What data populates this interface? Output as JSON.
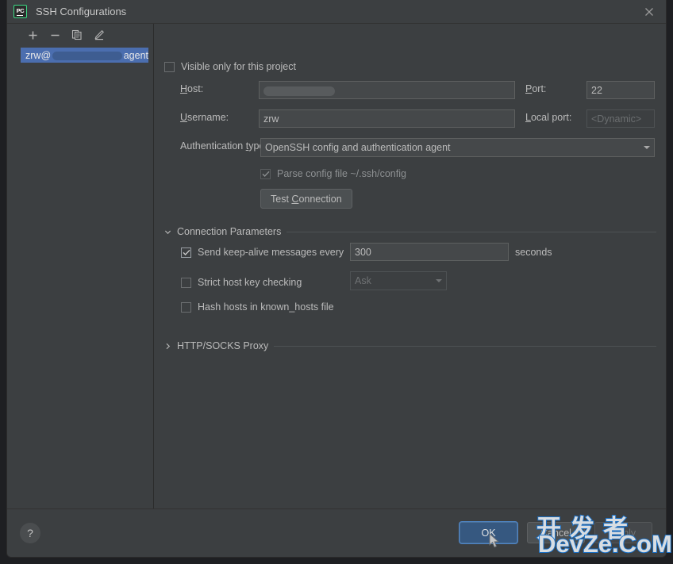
{
  "window": {
    "title": "SSH Configurations",
    "app_icon": "pycharm-icon",
    "app_icon_text": "PC",
    "close_icon": "close-icon"
  },
  "sidebar": {
    "toolbar": [
      {
        "name": "add-button",
        "icon": "plus-icon",
        "label": "+"
      },
      {
        "name": "remove-button",
        "icon": "minus-icon",
        "label": "−"
      },
      {
        "name": "copy-button",
        "icon": "copy-icon",
        "label": ""
      },
      {
        "name": "edit-button",
        "icon": "pencil-icon",
        "label": ""
      }
    ],
    "items": [
      {
        "prefix": "zrw@",
        "redacted": true,
        "suffix": "agent",
        "selected": true
      }
    ]
  },
  "form": {
    "visible_only_label": "Visible only for this project",
    "visible_only_checked": false,
    "host_label": "Host:",
    "host_label_mnemonic": "H",
    "host_value": "",
    "host_redacted": true,
    "port_label": "Port:",
    "port_label_mnemonic": "P",
    "port_value": "22",
    "username_label": "Username:",
    "username_label_mnemonic": "U",
    "username_value": "zrw",
    "local_port_label": "Local port:",
    "local_port_label_mnemonic": "L",
    "local_port_placeholder": "<Dynamic>",
    "auth_type_label": "Authentication type:",
    "auth_type_label_mnemonic": "t",
    "auth_type_value": "OpenSSH config and authentication agent",
    "parse_config_label": "Parse config file ~/.ssh/config",
    "parse_config_checked": true,
    "parse_config_disabled": true,
    "test_connection_label": "Test Connection",
    "test_connection_mnemonic": "C"
  },
  "connection_parameters": {
    "section_label": "Connection Parameters",
    "expanded": true,
    "keepalive_label": "Send keep-alive messages every",
    "keepalive_checked": true,
    "keepalive_value": "300",
    "keepalive_unit": "seconds",
    "strict_host_label": "Strict host key checking",
    "strict_host_checked": false,
    "strict_host_value": "Ask",
    "strict_host_disabled": true,
    "hash_hosts_label": "Hash hosts in known_hosts file",
    "hash_hosts_checked": false
  },
  "proxy": {
    "section_label": "HTTP/SOCKS Proxy",
    "expanded": false
  },
  "footer": {
    "help_label": "?",
    "ok_label": "OK",
    "cancel_label": "Cancel",
    "apply_label": "Apply",
    "apply_disabled": true
  },
  "watermark": {
    "line1": "开发者",
    "line2": "DevZe.CoM",
    "stroke_color": "#1a6fc4",
    "fill_color": "#d8dde2"
  },
  "colors": {
    "dialog_bg": "#3c3f41",
    "field_bg": "#45484a",
    "selection_blue": "#4b6eaf",
    "primary_button": "#365880",
    "focus_ring": "#4e86c7"
  }
}
